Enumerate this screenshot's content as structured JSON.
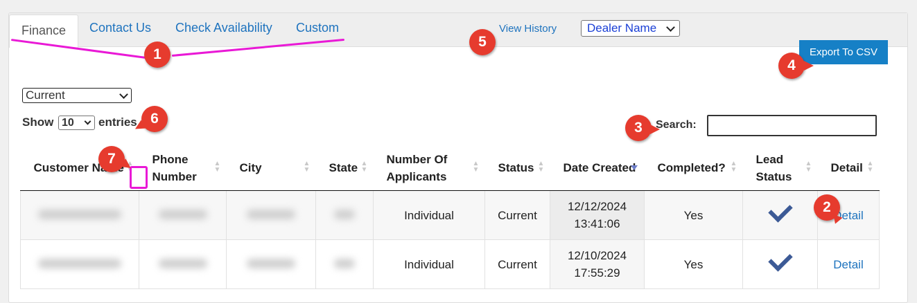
{
  "tabs": [
    {
      "label": "Finance",
      "active": true
    },
    {
      "label": "Contact Us",
      "active": false
    },
    {
      "label": "Check Availability",
      "active": false
    },
    {
      "label": "Custom",
      "active": false
    }
  ],
  "header": {
    "view_history": "View History",
    "dealer_select": "Dealer Name"
  },
  "toolbar": {
    "export_label": "Export To CSV"
  },
  "filters": {
    "status_select": "Current",
    "show_label": "Show",
    "page_length": "10",
    "entries_label": "entries",
    "search_label": "Search:",
    "search_value": ""
  },
  "table": {
    "columns": [
      {
        "label": "Customer Name"
      },
      {
        "label": "Phone Number"
      },
      {
        "label": "City"
      },
      {
        "label": "State"
      },
      {
        "label": "Number Of Applicants"
      },
      {
        "label": "Status"
      },
      {
        "label": "Date Created"
      },
      {
        "label": "Completed?"
      },
      {
        "label": "Lead Status"
      },
      {
        "label": "Detail"
      }
    ],
    "sorted_column": "Date Created",
    "sort_direction": "descending",
    "rows": [
      {
        "applicants": "Individual",
        "status": "Current",
        "date_line1": "12/12/2024",
        "date_line2": "13:41:06",
        "completed": "Yes",
        "detail": "Detail"
      },
      {
        "applicants": "Individual",
        "status": "Current",
        "date_line1": "12/10/2024",
        "date_line2": "17:55:29",
        "completed": "Yes",
        "detail": "Detail"
      }
    ]
  },
  "annotations": {
    "badges": [
      "1",
      "2",
      "3",
      "4",
      "5",
      "6",
      "7"
    ],
    "badge_color": "#e63b2e",
    "highlight_color": "#e919d6"
  },
  "colors": {
    "link": "#1e73be",
    "export_button": "#1680c6",
    "check": "#3c5a96"
  }
}
